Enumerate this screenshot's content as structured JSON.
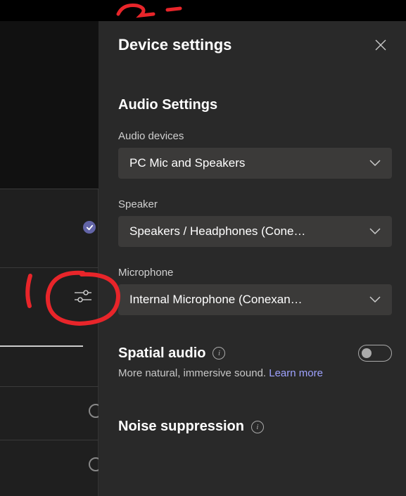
{
  "panel": {
    "title": "Device settings",
    "section_title": "Audio Settings",
    "audio_devices_label": "Audio devices",
    "audio_devices_value": "PC Mic and Speakers",
    "speaker_label": "Speaker",
    "speaker_value": "Speakers / Headphones (Cone…",
    "microphone_label": "Microphone",
    "microphone_value": "Internal Microphone (Conexan…",
    "spatial_audio_title": "Spatial audio",
    "spatial_audio_help": "More natural, immersive sound. ",
    "learn_more": "Learn more",
    "noise_title": "Noise suppression"
  }
}
